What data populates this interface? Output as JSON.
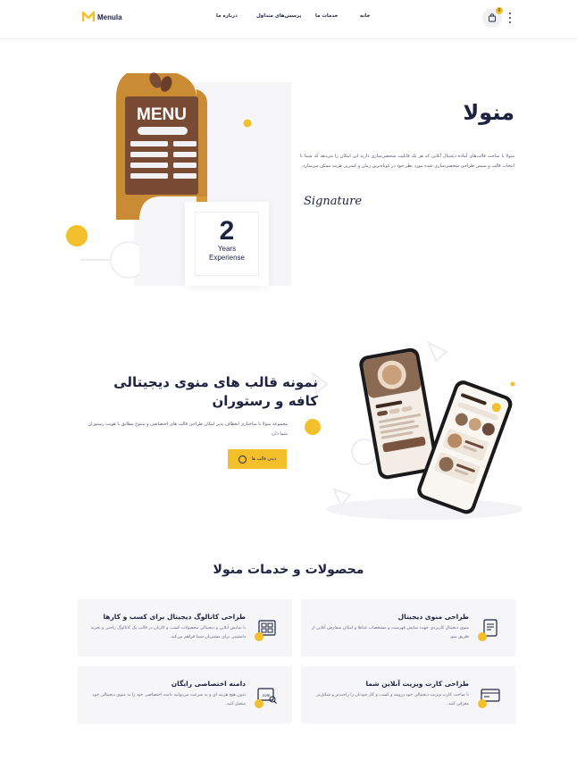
{
  "header": {
    "logo_text": "Menula",
    "nav": [
      "خانه",
      "خدمات ما",
      "پرسش‌های متداول",
      "درباره ما"
    ],
    "cart_count": "0"
  },
  "hero": {
    "title": "منولا",
    "description": "منولا با ساخت قالب‌های آماده دیجیتال آنلاین که هر یک قابلیت شخصی‌سازی دارند این امکان را می‌دهد که شما با انتخاب قالب و سپس طراحی شخصی‌سازی شده مورد نظر خود در کوتاه‌ترین زمان و کمترین هزینه ممکن می‌سازد.",
    "signature": "Signature",
    "menu_board_label": "MENU",
    "years_number": "2",
    "years_line1": "Years",
    "years_line2": "Experiense"
  },
  "templates": {
    "title": "نمونه قالب های منوی دیجیتالی کافه و رستوران",
    "description": "مجموعه منولا با ساختاری انعطاف پذیر امکان طراحی قالب های اختصاصی و متنوع مطابق با هویت رستوران شما دارد",
    "button_label": "دیدن قالب ها"
  },
  "products": {
    "title": "محصولات و خدمات منولا",
    "cards": [
      {
        "title": "طراحی منوی دیجیتال",
        "desc": "منوی دیجیتال کاربردی جهت نمایش فهرست و مشخصات غذاها و امکان سفارش آنلاین از طریق منو.",
        "icon": "menu-doc-icon"
      },
      {
        "title": "طراحی کاتالوگ دیجیتال برای کسب و کارها",
        "desc": "با نمایش آنلاین و دیجیتالی محصولات کسب و کارتان در قالب یک کاتالوگ راحتی و تجربه دلنشینی برای مشتریان شما فراهم می‌کند.",
        "icon": "catalog-icon"
      },
      {
        "title": "طراحی کارت ویزیت آنلاین شما",
        "desc": "با ساخت کارت ویزیت دیجیتالی خود رزومه و کسب و کار خودتان را راحت‌تر و شکیل‌تر معرفی کنید.",
        "icon": "card-icon"
      },
      {
        "title": "دامنه اختصاصی رایگان",
        "desc": "بدون هیچ هزینه ای و به سرعت می‌توانید دامنه اختصاصی خود را به منوی دیجیتالی خود متصل کنید.",
        "icon": "domain-icon"
      }
    ]
  },
  "colors": {
    "accent": "#f3bf2a",
    "text_dark": "#1f2240",
    "menu_wood": "#c98b33",
    "menu_board": "#7a4b34"
  }
}
